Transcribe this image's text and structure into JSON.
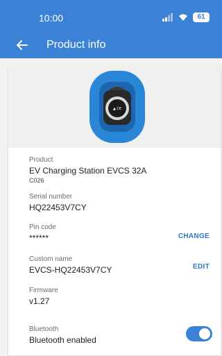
{
  "status": {
    "time": "10:00",
    "battery": "61"
  },
  "header": {
    "title": "Product info",
    "back_icon": "arrow-left-icon"
  },
  "product": {
    "label": "Product",
    "name": "EV Charging Station EVCS 32A",
    "code": "C026"
  },
  "serial": {
    "label": "Serial number",
    "value": "HQ22453V7CY"
  },
  "pin": {
    "label": "Pin code",
    "value": "******",
    "action": "CHANGE"
  },
  "custom_name": {
    "label": "Custom name",
    "value": "EVCS-HQ22453V7CY",
    "action": "EDIT"
  },
  "firmware": {
    "label": "Firmware",
    "value": "v1.27"
  },
  "bluetooth": {
    "label": "Bluetooth",
    "value": "Bluetooth enabled",
    "enabled": true
  },
  "colors": {
    "accent": "#3b82d7",
    "action_text": "#2f78c9"
  }
}
